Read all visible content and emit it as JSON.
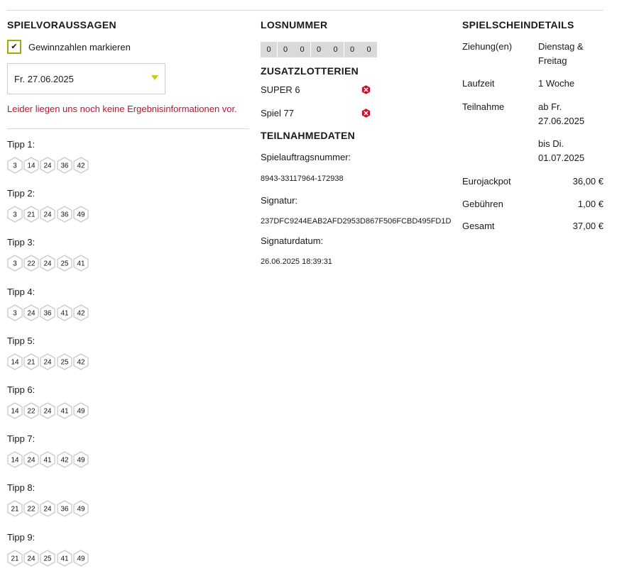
{
  "left": {
    "title": "SPIELVORAUSSAGEN",
    "checkbox_label": "Gewinnzahlen markieren",
    "checkbox_mark": "✔",
    "date_value": "Fr. 27.06.2025",
    "notice": "Leider liegen uns noch keine Ergebnisinformationen vor.",
    "tipps": [
      {
        "label": "Tipp 1:",
        "numbers": [
          "3",
          "14",
          "24",
          "36",
          "42"
        ]
      },
      {
        "label": "Tipp 2:",
        "numbers": [
          "3",
          "21",
          "24",
          "36",
          "49"
        ]
      },
      {
        "label": "Tipp 3:",
        "numbers": [
          "3",
          "22",
          "24",
          "25",
          "41"
        ]
      },
      {
        "label": "Tipp 4:",
        "numbers": [
          "3",
          "24",
          "36",
          "41",
          "42"
        ]
      },
      {
        "label": "Tipp 5:",
        "numbers": [
          "14",
          "21",
          "24",
          "25",
          "42"
        ]
      },
      {
        "label": "Tipp 6:",
        "numbers": [
          "14",
          "22",
          "24",
          "41",
          "49"
        ]
      },
      {
        "label": "Tipp 7:",
        "numbers": [
          "14",
          "24",
          "41",
          "42",
          "49"
        ]
      },
      {
        "label": "Tipp 8:",
        "numbers": [
          "21",
          "22",
          "24",
          "36",
          "49"
        ]
      },
      {
        "label": "Tipp 9:",
        "numbers": [
          "21",
          "24",
          "25",
          "41",
          "49"
        ]
      }
    ]
  },
  "middle": {
    "losnummer_title": "LOSNUMMER",
    "losnummer_digits": [
      "0",
      "0",
      "0",
      "0",
      "0",
      "0",
      "0"
    ],
    "zusatz_title": "ZUSATZLOTTERIEN",
    "zusatz": [
      {
        "name": "SUPER 6",
        "icon": "x-hexagon-icon"
      },
      {
        "name": "Spiel 77",
        "icon": "x-hexagon-icon"
      }
    ],
    "teilnahme_title": "TEILNAHMEDATEN",
    "auftrag_label": "Spielauftragsnummer:",
    "auftrag_value": "8943-33117964-172938",
    "signatur_label": "Signatur:",
    "signatur_value": "237DFC9244EAB2AFD2953D867F506FCBD495FD1D",
    "signaturdatum_label": "Signaturdatum:",
    "signaturdatum_value": "26.06.2025 18:39:31"
  },
  "right": {
    "title": "SPIELSCHEINDETAILS",
    "ziehung_label": "Ziehung(en)",
    "ziehung_value": "Dienstag & Freitag",
    "laufzeit_label": "Laufzeit",
    "laufzeit_value": "1 Woche",
    "teilnahme_label": "Teilnahme",
    "teilnahme_from": "ab Fr. 27.06.2025",
    "teilnahme_to": "bis Di. 01.07.2025",
    "eurojackpot_label": "Eurojackpot",
    "eurojackpot_value": "36,00 €",
    "gebuehren_label": "Gebühren",
    "gebuehren_value": "1,00 €",
    "gesamt_label": "Gesamt",
    "gesamt_value": "37,00 €"
  },
  "colors": {
    "accent": "#c3cf1a",
    "checkbox_border": "#a0a810",
    "error": "#c8102e",
    "digit_bg": "#d9d9d9"
  }
}
